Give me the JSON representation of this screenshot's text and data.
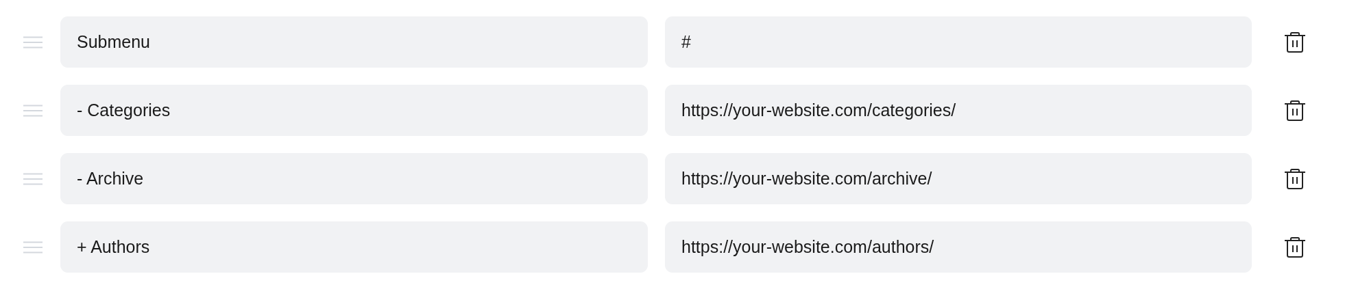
{
  "menu_items": [
    {
      "label": "Submenu",
      "url": "#"
    },
    {
      "label": "- Categories",
      "url": "https://your-website.com/categories/"
    },
    {
      "label": "- Archive",
      "url": "https://your-website.com/archive/"
    },
    {
      "label": "+ Authors",
      "url": "https://your-website.com/authors/"
    }
  ]
}
